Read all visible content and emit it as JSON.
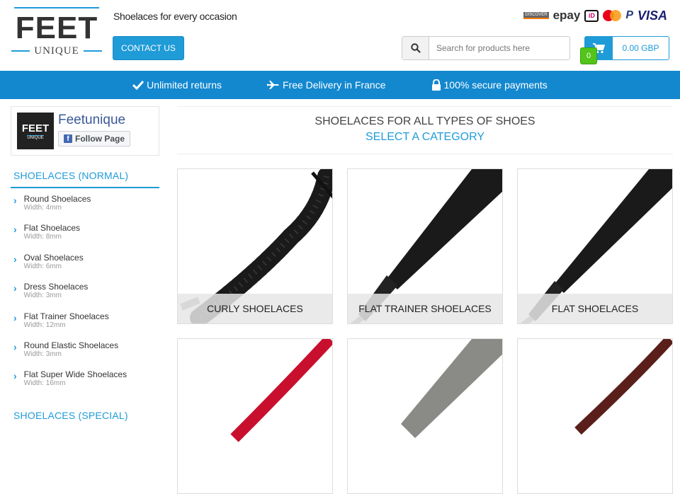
{
  "header": {
    "logo": {
      "main": "FEET",
      "sub": "UNIQUE"
    },
    "tagline": "Shoelaces for every occasion",
    "contact_label": "CONTACT US",
    "payments": {
      "discover": "DISCOVER",
      "epay": "epay",
      "ideal": "iD",
      "paypal": "P",
      "visa": "VISA"
    },
    "search": {
      "placeholder": "Search for products here",
      "value": ""
    },
    "cart": {
      "count": "0",
      "total": "0.00 GBP"
    }
  },
  "benefits": [
    {
      "icon": "check-icon",
      "label": "Unlimited returns"
    },
    {
      "icon": "plane-icon",
      "label": "Free Delivery in France"
    },
    {
      "icon": "lock-icon",
      "label": "100% secure payments"
    }
  ],
  "sidebar": {
    "facebook": {
      "page_name": "Feetunique",
      "follow_label": "Follow Page",
      "thumb_main": "FEET",
      "thumb_sub": "UNIQUE"
    },
    "categories_title": "SHOELACES (NORMAL)",
    "categories": [
      {
        "name": "Round Shoelaces",
        "width": "Width: 4mm"
      },
      {
        "name": "Flat Shoelaces",
        "width": "Width: 8mm"
      },
      {
        "name": "Oval Shoelaces",
        "width": "Width: 6mm"
      },
      {
        "name": "Dress Shoelaces",
        "width": "Width: 3mm"
      },
      {
        "name": "Flat Trainer Shoelaces",
        "width": "Width: 12mm"
      },
      {
        "name": "Round Elastic Shoelaces",
        "width": "Width: 3mm"
      },
      {
        "name": "Flat Super Wide Shoelaces",
        "width": "Width: 16mm"
      }
    ],
    "categories_title_2": "SHOELACES (SPECIAL)"
  },
  "main": {
    "title": "SHOELACES FOR ALL TYPES OF SHOES",
    "subtitle": "SELECT A CATEGORY",
    "products": [
      {
        "label": "CURLY SHOELACES",
        "color": "#1a1a1a"
      },
      {
        "label": "FLAT TRAINER SHOELACES",
        "color": "#1a1a1a"
      },
      {
        "label": "FLAT SHOELACES",
        "color": "#1a1a1a"
      },
      {
        "label": "",
        "color": "#c8102e"
      },
      {
        "label": "",
        "color": "#8a8a86"
      },
      {
        "label": "",
        "color": "#5a1f1a"
      }
    ]
  },
  "colors": {
    "accent": "#1f9bd8",
    "bar": "#1388cf",
    "badge": "#52c41a"
  }
}
